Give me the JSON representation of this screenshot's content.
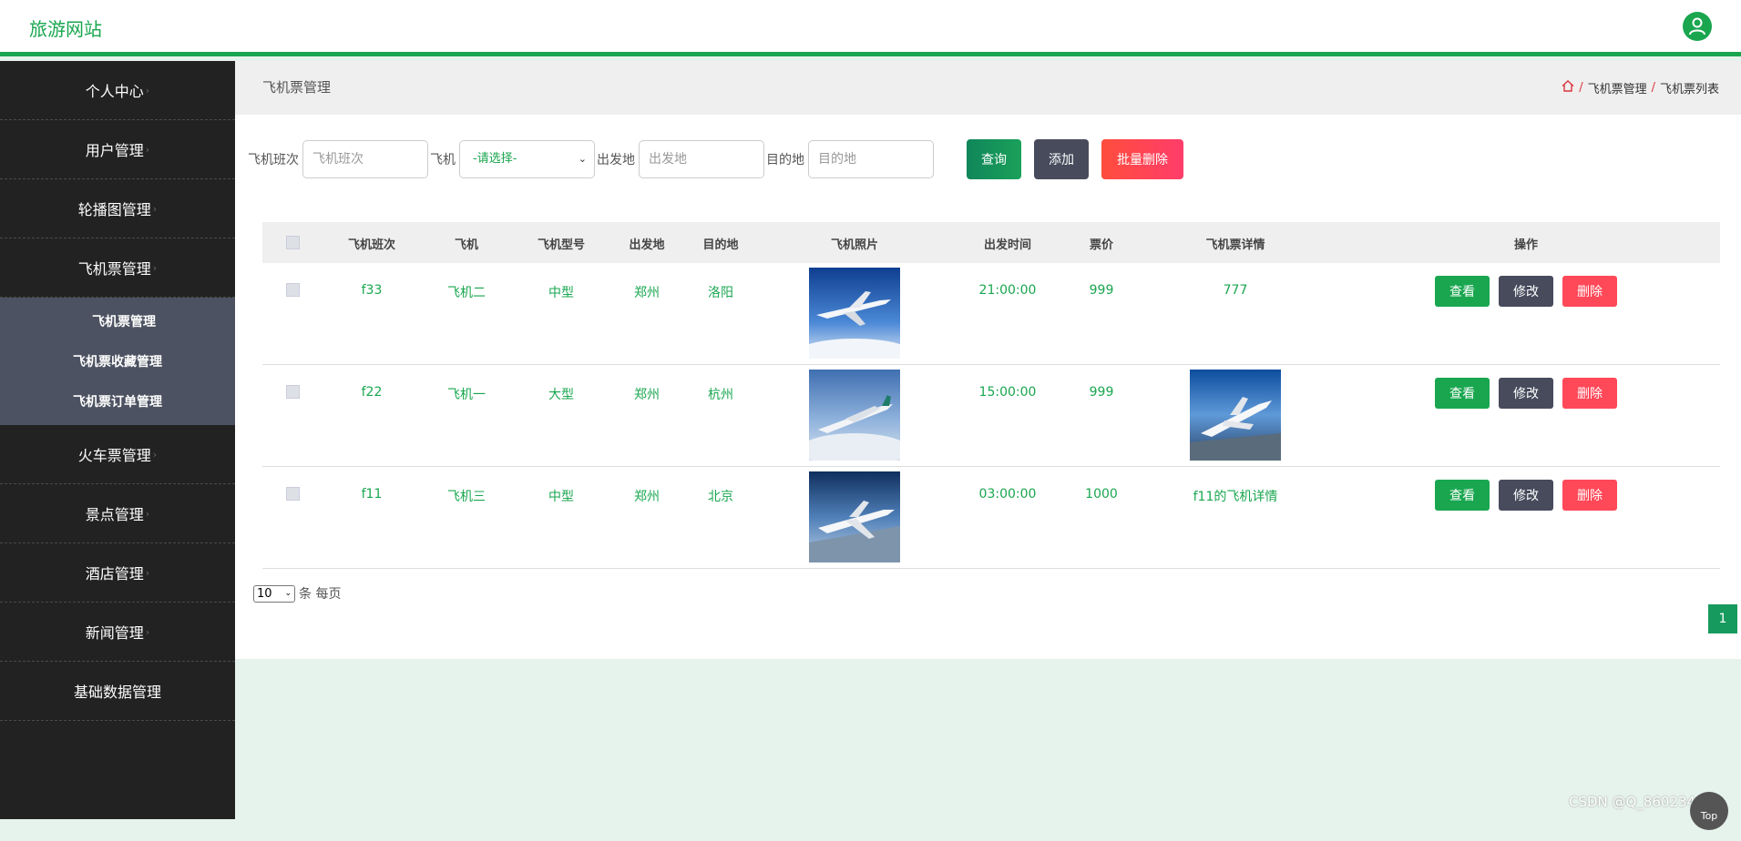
{
  "header": {
    "site_title": "旅游网站"
  },
  "sidebar": {
    "items": [
      {
        "label": "个人中心"
      },
      {
        "label": "用户管理"
      },
      {
        "label": "轮播图管理"
      },
      {
        "label": "飞机票管理"
      }
    ],
    "submenu": [
      {
        "label": "飞机票管理"
      },
      {
        "label": "飞机票收藏管理"
      },
      {
        "label": "飞机票订单管理"
      }
    ],
    "items_after": [
      {
        "label": "火车票管理"
      },
      {
        "label": "景点管理"
      },
      {
        "label": "酒店管理"
      },
      {
        "label": "新闻管理"
      },
      {
        "label": "基础数据管理"
      }
    ],
    "chevron": "›"
  },
  "breadcrumb": {
    "page_title": "飞机票管理",
    "sep": "/",
    "crumbs": [
      "飞机票管理",
      "飞机票列表"
    ]
  },
  "filters": {
    "flight_no": {
      "label": "飞机班次",
      "placeholder": "飞机班次"
    },
    "plane": {
      "label": "飞机",
      "value": "-请选择-"
    },
    "origin": {
      "label": "出发地",
      "placeholder": "出发地"
    },
    "destination": {
      "label": "目的地",
      "placeholder": "目的地"
    },
    "query_label": "查询",
    "add_label": "添加",
    "batch_delete_label": "批量删除"
  },
  "table": {
    "columns": [
      "飞机班次",
      "飞机",
      "飞机型号",
      "出发地",
      "目的地",
      "飞机照片",
      "出发时间",
      "票价",
      "飞机票详情",
      "操作"
    ],
    "rows": [
      {
        "flight": "f33",
        "plane": "飞机二",
        "model": "中型",
        "from": "郑州",
        "to": "洛阳",
        "time": "21:00:00",
        "price": "999",
        "detail": "777"
      },
      {
        "flight": "f22",
        "plane": "飞机一",
        "model": "大型",
        "from": "郑州",
        "to": "杭州",
        "time": "15:00:00",
        "price": "999",
        "detail": ""
      },
      {
        "flight": "f11",
        "plane": "飞机三",
        "model": "中型",
        "from": "郑州",
        "to": "北京",
        "time": "03:00:00",
        "price": "1000",
        "detail": "f11的飞机详情"
      }
    ],
    "actions": {
      "view": "查看",
      "edit": "修改",
      "delete": "删除"
    }
  },
  "pagination": {
    "page_size": "10",
    "page_size_suffix": "条 每页",
    "current_page": "1"
  },
  "watermark": "CSDN @Q_860234001",
  "back_to_top": "Top",
  "colors": {
    "accent": "#19a64f",
    "sidebar": "#222222",
    "submenu": "#4c5261",
    "danger": "#ff4858",
    "dark_button": "#474b5c"
  }
}
